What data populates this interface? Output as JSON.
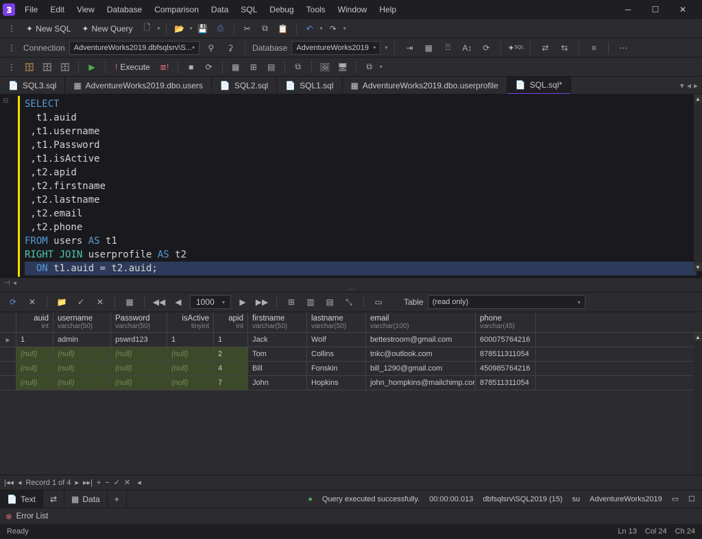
{
  "menu": [
    "File",
    "Edit",
    "View",
    "Database",
    "Comparison",
    "Data",
    "SQL",
    "Debug",
    "Tools",
    "Window",
    "Help"
  ],
  "toolbar1": {
    "newSql": "New SQL",
    "newQuery": "New Query"
  },
  "conn": {
    "label": "Connection",
    "value": "AdventureWorks2019.dbfsqlsrv\\S...",
    "dbLabel": "Database",
    "dbValue": "AdventureWorks2019"
  },
  "exec": {
    "execute": "Execute"
  },
  "tabs": [
    {
      "label": "SQL3.sql",
      "icon": "sql"
    },
    {
      "label": "AdventureWorks2019.dbo.users",
      "icon": "table"
    },
    {
      "label": "SQL2.sql",
      "icon": "sql"
    },
    {
      "label": "SQL1.sql",
      "icon": "sql"
    },
    {
      "label": "AdventureWorks2019.dbo.userprofile",
      "icon": "table"
    },
    {
      "label": "SQL.sql*",
      "icon": "sql",
      "active": true
    }
  ],
  "code": [
    [
      {
        "t": "SELECT",
        "c": "kw-blue"
      }
    ],
    [
      {
        "t": "  t1.auid",
        "c": "txt-id"
      }
    ],
    [
      {
        "t": " ,t1.username",
        "c": "txt-id"
      }
    ],
    [
      {
        "t": " ,t1.Password",
        "c": "txt-id"
      }
    ],
    [
      {
        "t": " ,t1.isActive",
        "c": "txt-id"
      }
    ],
    [
      {
        "t": " ,t2.apid",
        "c": "txt-id"
      }
    ],
    [
      {
        "t": " ,t2.firstname",
        "c": "txt-id"
      }
    ],
    [
      {
        "t": " ,t2.lastname",
        "c": "txt-id"
      }
    ],
    [
      {
        "t": " ,t2.email",
        "c": "txt-id"
      }
    ],
    [
      {
        "t": " ,t2.phone",
        "c": "txt-id"
      }
    ],
    [
      {
        "t": "FROM",
        "c": "kw-blue"
      },
      {
        "t": " users ",
        "c": "txt-id"
      },
      {
        "t": "AS",
        "c": "kw-blue"
      },
      {
        "t": " t1",
        "c": "txt-id"
      }
    ],
    [
      {
        "t": "RIGHT JOIN",
        "c": "kw-cyan"
      },
      {
        "t": " userprofile ",
        "c": "txt-id"
      },
      {
        "t": "AS",
        "c": "kw-blue"
      },
      {
        "t": " t2",
        "c": "txt-id"
      }
    ],
    [
      {
        "t": "  ",
        "c": "txt-id"
      },
      {
        "t": "ON",
        "c": "kw-blue"
      },
      {
        "t": " t1.auid = t2.auid;",
        "c": "txt-id"
      }
    ]
  ],
  "gridToolbar": {
    "count": "1000",
    "tableLabel": "Table",
    "tableMode": "(read only)"
  },
  "columns": [
    {
      "name": "auid",
      "type": "int",
      "cls": "c-auid"
    },
    {
      "name": "username",
      "type": "varchar(50)",
      "cls": "c-un"
    },
    {
      "name": "Password",
      "type": "varchar(50)",
      "cls": "c-pw"
    },
    {
      "name": "isActive",
      "type": "tinyint",
      "cls": "c-ia"
    },
    {
      "name": "apid",
      "type": "int",
      "cls": "c-apid"
    },
    {
      "name": "firstname",
      "type": "varchar(50)",
      "cls": "c-fn"
    },
    {
      "name": "lastname",
      "type": "varchar(50)",
      "cls": "c-ln"
    },
    {
      "name": "email",
      "type": "varchar(100)",
      "cls": "c-em"
    },
    {
      "name": "phone",
      "type": "varchar(45)",
      "cls": "c-ph"
    }
  ],
  "rows": [
    {
      "current": true,
      "cells": [
        "1",
        "admin",
        "pswrd123",
        "1",
        "1",
        "Jack",
        "Wolf",
        "bettestroom@gmail.com",
        "600075764216"
      ]
    },
    {
      "null": true,
      "cells": [
        "(null)",
        "(null)",
        "(null)",
        "(null)",
        "2",
        "Tom",
        "Collins",
        "tnkc@outlook.com",
        "878511311054"
      ]
    },
    {
      "null": true,
      "cells": [
        "(null)",
        "(null)",
        "(null)",
        "(null)",
        "4",
        "Bill",
        "Fonskin",
        "bill_1290@gmail.com",
        "450985764216"
      ]
    },
    {
      "null": true,
      "cells": [
        "(null)",
        "(null)",
        "(null)",
        "(null)",
        "7",
        "John",
        "Hopkins",
        "john_hompkins@mailchimp.com",
        "878511311054"
      ]
    }
  ],
  "recordNav": {
    "label": "Record 1 of 4"
  },
  "bottomTabs": {
    "text": "Text",
    "data": "Data"
  },
  "status": {
    "msg": "Query executed successfully.",
    "time": "00:00:00.013",
    "server": "dbfsqlsrv\\SQL2019 (15)",
    "user": "su",
    "db": "AdventureWorks2019"
  },
  "errorList": "Error List",
  "ready": "Ready",
  "cursor": {
    "ln": "Ln 13",
    "col": "Col 24",
    "ch": "Ch 24"
  }
}
